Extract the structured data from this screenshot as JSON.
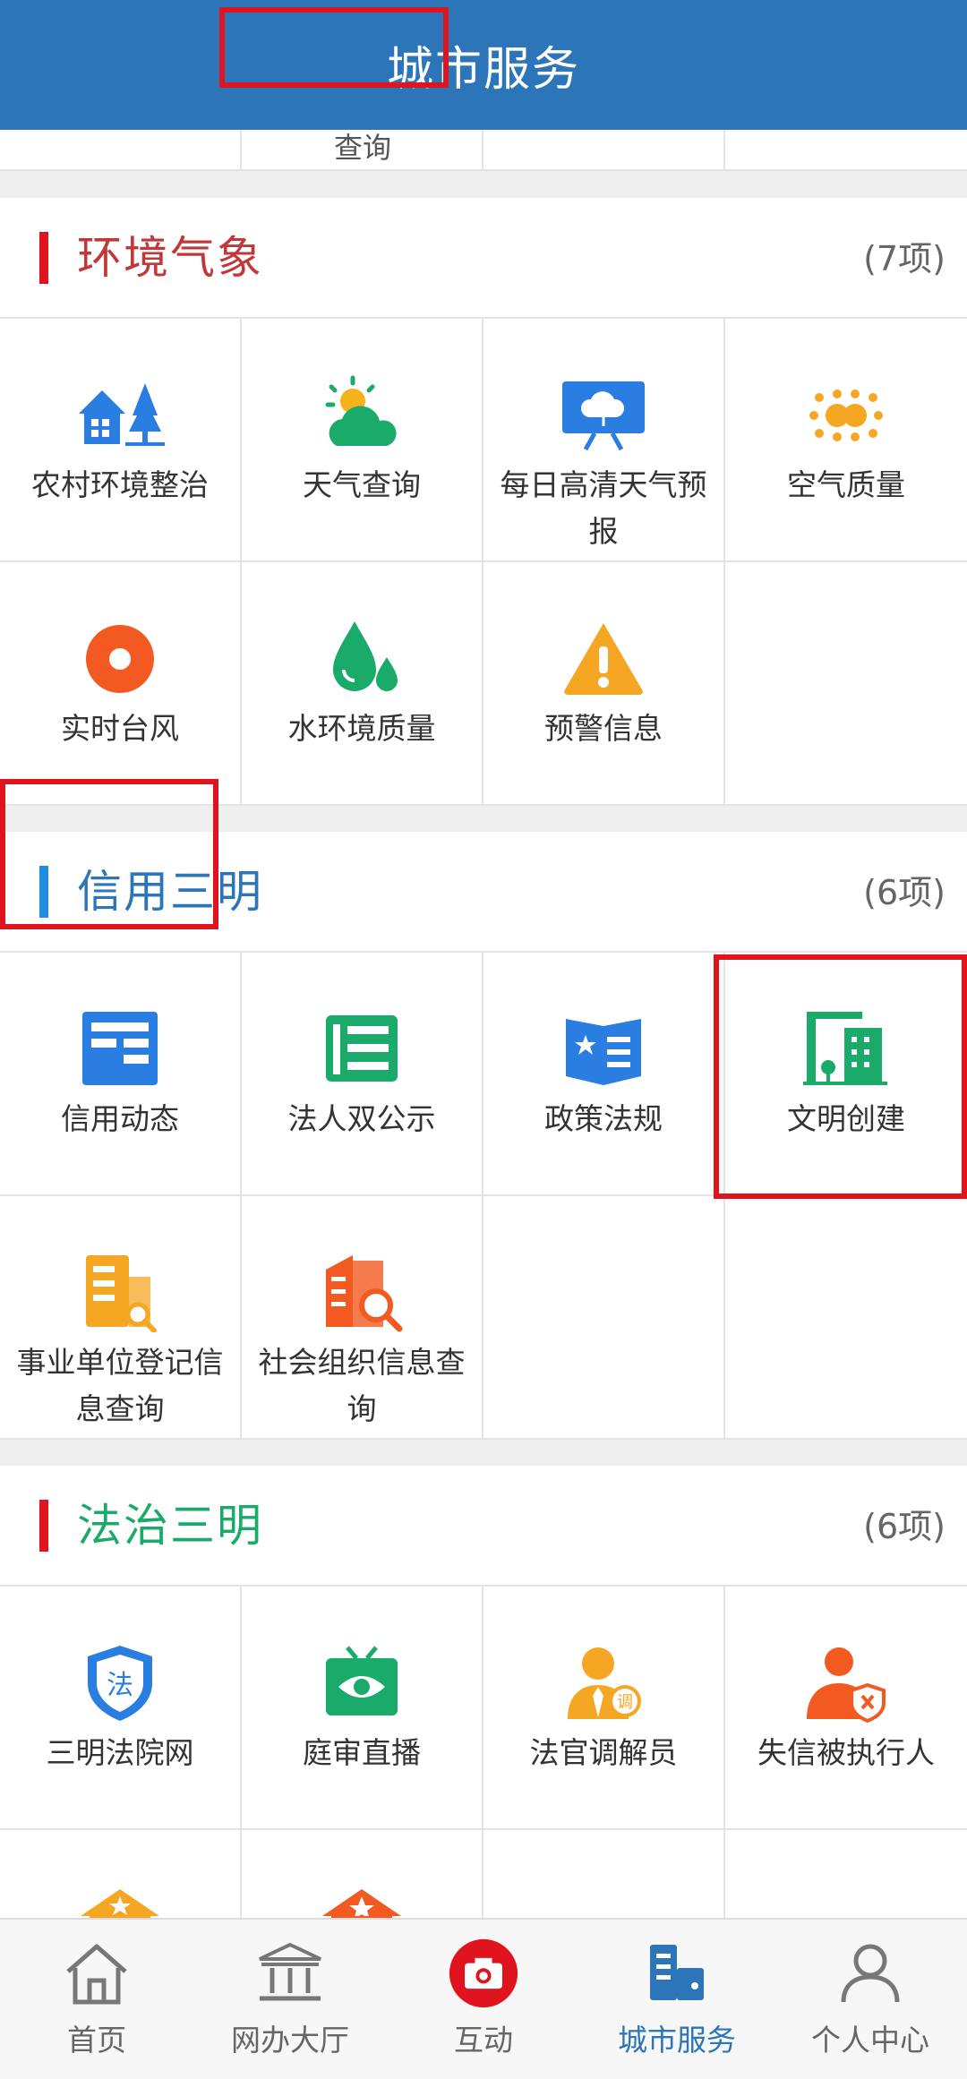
{
  "header": {
    "title": "城市服务"
  },
  "prev_section": {
    "visible_label": "查询"
  },
  "sections": [
    {
      "id": "env",
      "title": "环境气象",
      "count": "(7项)",
      "title_color": "#c2373a",
      "bar_color": "#e0141e",
      "items": [
        {
          "label": "农村环境整治",
          "icon": "village-trees-icon"
        },
        {
          "label": "天气查询",
          "icon": "sun-cloud-icon"
        },
        {
          "label": "每日高清天气预报",
          "icon": "weather-screen-icon"
        },
        {
          "label": "空气质量",
          "icon": "air-dots-icon"
        },
        {
          "label": "实时台风",
          "icon": "typhoon-icon"
        },
        {
          "label": "水环境质量",
          "icon": "water-drop-icon"
        },
        {
          "label": "预警信息",
          "icon": "warning-icon"
        }
      ]
    },
    {
      "id": "credit",
      "title": "信用三明",
      "count": "(6项)",
      "title_color": "#2c75b9",
      "bar_color": "#1e8fe0",
      "items": [
        {
          "label": "信用动态",
          "icon": "news-icon"
        },
        {
          "label": "法人双公示",
          "icon": "list-document-icon"
        },
        {
          "label": "政策法规",
          "icon": "policy-book-icon"
        },
        {
          "label": "文明创建",
          "icon": "civic-building-icon"
        },
        {
          "label": "事业单位登记信息查询",
          "icon": "unit-search-icon"
        },
        {
          "label": "社会组织信息查询",
          "icon": "org-search-icon"
        }
      ]
    },
    {
      "id": "law",
      "title": "法治三明",
      "count": "(6项)",
      "title_color": "#1aaa6a",
      "bar_color": "#e0141e",
      "items": [
        {
          "label": "三明法院网",
          "icon": "law-shield-icon"
        },
        {
          "label": "庭审直播",
          "icon": "tv-eye-icon"
        },
        {
          "label": "法官调解员",
          "icon": "mediator-icon"
        },
        {
          "label": "失信被执行人",
          "icon": "dishonest-person-icon"
        },
        {
          "label": "",
          "icon": "house-star-yellow-icon"
        },
        {
          "label": "",
          "icon": "house-star-orange-icon"
        }
      ]
    }
  ],
  "tabbar": [
    {
      "label": "首页",
      "icon": "home-icon",
      "active": false
    },
    {
      "label": "网办大厅",
      "icon": "hall-icon",
      "active": false
    },
    {
      "label": "互动",
      "icon": "camera-icon",
      "active": false
    },
    {
      "label": "城市服务",
      "icon": "city-service-icon",
      "active": true
    },
    {
      "label": "个人中心",
      "icon": "person-icon",
      "active": false
    }
  ],
  "colors": {
    "header_bg": "#2c75b9",
    "highlight_border": "#e0141e",
    "active_tab": "#2c75b9"
  }
}
